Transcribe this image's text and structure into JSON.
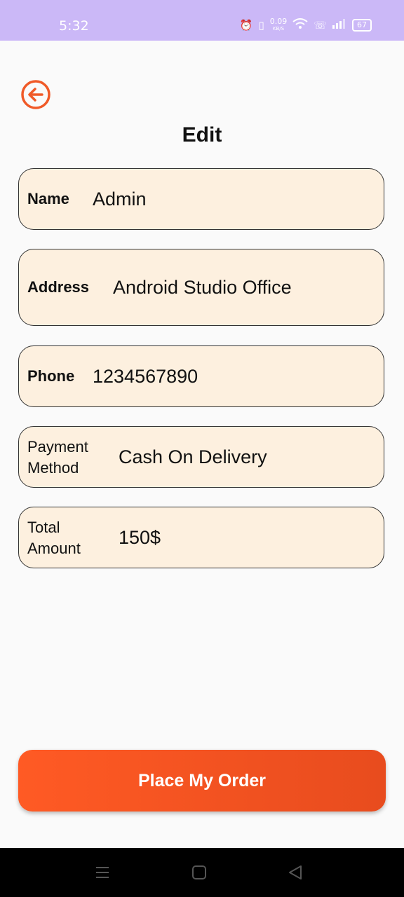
{
  "status_bar": {
    "time": "5:32",
    "speed_value": "0.09",
    "speed_unit": "KB/S",
    "battery": "67"
  },
  "header": {
    "title": "Edit"
  },
  "form": {
    "name": {
      "label": "Name",
      "value": "Admin"
    },
    "address": {
      "label": "Address",
      "value": "Android Studio Office"
    },
    "phone": {
      "label": "Phone",
      "value": "1234567890"
    },
    "payment": {
      "label_line1": "Payment",
      "label_line2": "Method",
      "value": "Cash On Delivery"
    },
    "total": {
      "label_line1": "Total",
      "label_line2": "Amount",
      "value": "150$"
    }
  },
  "actions": {
    "place_order_label": "Place My Order"
  },
  "colors": {
    "accent": "#f05a28",
    "field_bg": "#fdf0df",
    "status_bar": "#cbb8f7"
  }
}
